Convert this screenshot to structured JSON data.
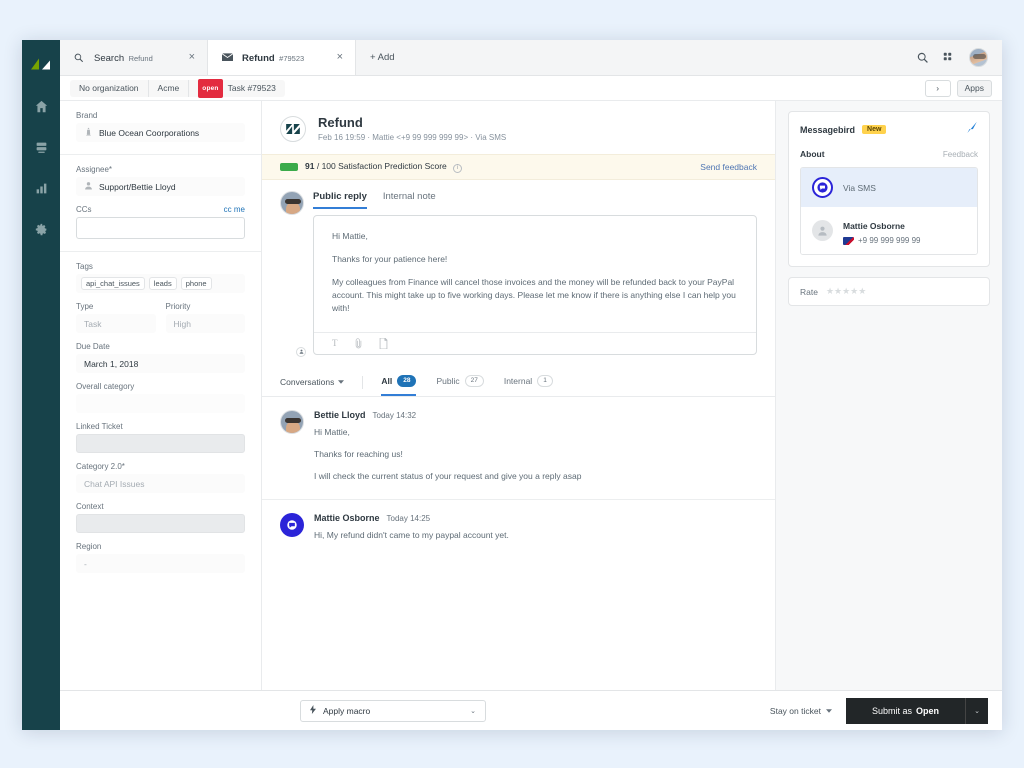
{
  "nav_rail": {
    "logo_name": "zendesk-logo",
    "items": [
      {
        "name": "home-icon",
        "label": "Home"
      },
      {
        "name": "views-icon",
        "label": "Views"
      },
      {
        "name": "reporting-icon",
        "label": "Reporting"
      },
      {
        "name": "settings-gear-icon",
        "label": "Settings"
      }
    ]
  },
  "tabbar": {
    "tabs": [
      {
        "icon": "search-icon",
        "title": "Search",
        "subtitle": "Refund",
        "active": false,
        "close": "×"
      },
      {
        "icon": "mail-icon",
        "title": "Refund",
        "subtitle": "#79523",
        "active": true,
        "close": "×"
      }
    ],
    "add_label": "+ Add",
    "search_icon": "search-icon",
    "apps_grid_icon": "apps-grid-icon",
    "avatar_icon": "user-avatar"
  },
  "breadcrumb": {
    "items": [
      "No organization",
      "Acme"
    ],
    "status_badge": "open",
    "current": "Task #79523",
    "next_button": "›",
    "apps_button": "Apps"
  },
  "sidebar": {
    "brand": {
      "label": "Brand",
      "value": "Blue Ocean Coorporations",
      "icon": "lighthouse-icon"
    },
    "assignee": {
      "label": "Assignee*",
      "value": "Support/Bettie Lloyd",
      "icon": "person-icon"
    },
    "ccs": {
      "label": "CCs",
      "link": "cc me",
      "value": ""
    },
    "tags": {
      "label": "Tags",
      "values": [
        "api_chat_issues",
        "leads",
        "phone"
      ]
    },
    "type": {
      "label": "Type",
      "value": "Task"
    },
    "priority": {
      "label": "Priority",
      "value": "High"
    },
    "due_date": {
      "label": "Due Date",
      "value": "March 1, 2018"
    },
    "overall_category": {
      "label": "Overall category",
      "value": ""
    },
    "linked_ticket": {
      "label": "Linked Ticket",
      "value": ""
    },
    "category_20": {
      "label": "Category 2.0*",
      "value": "Chat API Issues"
    },
    "context": {
      "label": "Context",
      "value": ""
    },
    "region": {
      "label": "Region",
      "value": "-"
    }
  },
  "ticket": {
    "brand_icon": "zendesk-brand-icon",
    "title": "Refund",
    "meta": "Feb 16 19:59  ·  Mattie <+9 99 999 999 99>  ·  Via SMS"
  },
  "satisfaction": {
    "score": "91",
    "scale": "/ 100 Satisfaction Prediction Score",
    "info_icon": "info-icon",
    "bar_color": "#3bab4a",
    "feedback_link": "Send feedback"
  },
  "composer": {
    "tabs": [
      {
        "label": "Public reply",
        "active": true
      },
      {
        "label": "Internal note",
        "active": false
      }
    ],
    "paragraphs": [
      "Hi Mattie,",
      "Thanks for your patience here!",
      "My colleagues from Finance will cancel those invoices and the money will be refunded back to your PayPal account. This might take up to five working days. Please let me know if there is anything else I can help you with!"
    ],
    "toolbar": [
      {
        "name": "text-format-icon",
        "glyph": "T"
      },
      {
        "name": "attachment-icon",
        "glyph": ""
      },
      {
        "name": "knowledge-article-icon",
        "glyph": ""
      }
    ]
  },
  "conversation_filters": {
    "selector": "Conversations",
    "tabs": [
      {
        "label": "All",
        "count": "28",
        "active": true
      },
      {
        "label": "Public",
        "count": "27",
        "active": false
      },
      {
        "label": "Internal",
        "count": "1",
        "active": false
      }
    ]
  },
  "messages": [
    {
      "avatar": "agent-photo",
      "name": "Bettie Lloyd",
      "time": "Today 14:32",
      "paragraphs": [
        "Hi Mattie,",
        "Thanks for reaching us!",
        "I will check the current status of your request and give you a reply asap"
      ]
    },
    {
      "avatar": "sms-channel-icon",
      "name": "Mattie Osborne",
      "time": "Today 14:25",
      "paragraphs": [
        "Hi, My refund didn't came to my paypal account yet."
      ]
    }
  ],
  "apps_panel": {
    "app_name": "Messagebird",
    "badge": "New",
    "logo_icon": "messagebird-logo",
    "section_title": "About",
    "feedback_link": "Feedback",
    "channel": {
      "icon": "messagebird-channel-icon",
      "label": "Via SMS"
    },
    "requester": {
      "avatar_icon": "person-avatar-icon",
      "name": "Mattie Osborne",
      "flag_icon": "flag-icon",
      "phone": "+9 99 999 999 99"
    },
    "rate": {
      "label": "Rate",
      "stars": "★★★★★",
      "filled": "0"
    }
  },
  "footer": {
    "macro": {
      "icon": "macro-bolt-icon",
      "label": "Apply macro",
      "caret": "⌄"
    },
    "stay_on_ticket": "Stay on ticket",
    "submit_prefix": "Submit as",
    "submit_status": "Open",
    "submit_caret": "⌄"
  },
  "colors": {
    "page_bg": "#e9f2fc",
    "rail_bg": "#17424a",
    "accent_blue": "#1f73b7",
    "status_open": "#e32b3f",
    "satisfaction_green": "#3bab4a",
    "badge_new": "#ffd24d",
    "sms_purple": "#2b24d8",
    "submit_dark": "#222628"
  }
}
